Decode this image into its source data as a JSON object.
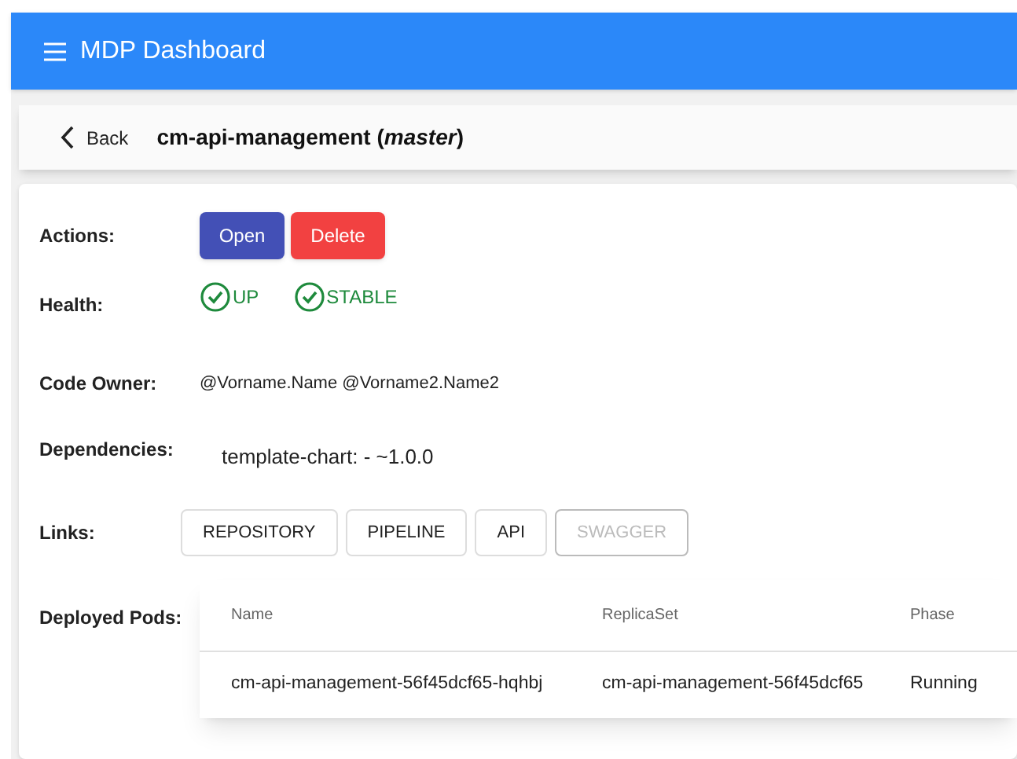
{
  "app_bar": {
    "title": "MDP Dashboard"
  },
  "header": {
    "back": "Back",
    "title": "cm-api-management (*master*)"
  },
  "actions": {
    "label": "Actions:",
    "buttons": [
      {
        "label": "Open",
        "kind": "primary"
      },
      {
        "label": "Delete",
        "kind": "danger"
      }
    ]
  },
  "health": {
    "label": "Health:",
    "items": [
      {
        "label": "UP",
        "ok": true
      },
      {
        "label": "STABLE",
        "ok": true
      }
    ]
  },
  "code_owner": {
    "label": "Code Owner:",
    "value": "@Vorname.Name @Vorname2.Name2"
  },
  "dependencies": {
    "label": "Dependencies:",
    "items": [
      "template-chart: - ~1.0.0"
    ]
  },
  "links": {
    "label": "Links:",
    "buttons": [
      {
        "label": "REPOSITORY",
        "disabled": false
      },
      {
        "label": "PIPELINE",
        "disabled": false
      },
      {
        "label": "API",
        "disabled": false
      },
      {
        "label": "SWAGGER",
        "disabled": true
      }
    ]
  },
  "pods": {
    "label": "Deployed Pods:",
    "columns": [
      "Name",
      "ReplicaSet",
      "Phase"
    ],
    "rows": [
      [
        "cm-api-management-56f45dcf65-hqhbj",
        "cm-api-management-56f45dcf65",
        "Running"
      ]
    ]
  }
}
